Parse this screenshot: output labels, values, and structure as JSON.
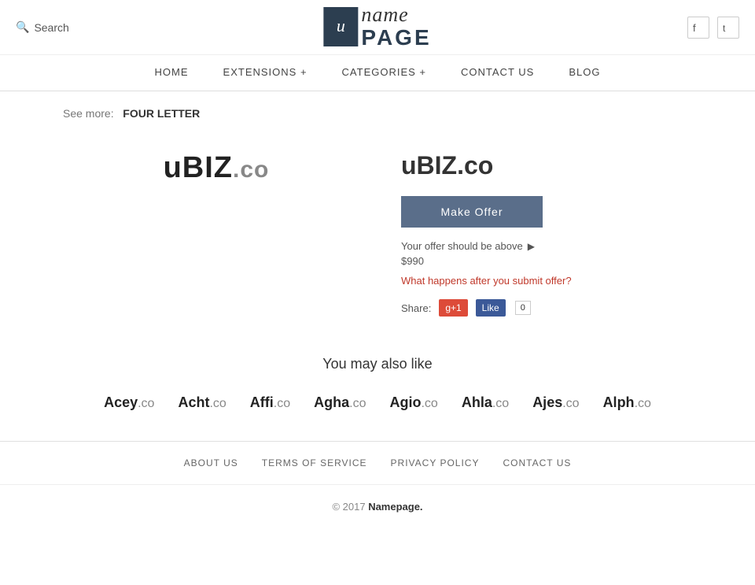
{
  "header": {
    "search_label": "Search",
    "logo_icon_text": "u",
    "logo_name": "name",
    "logo_page": "PAGE",
    "social": {
      "facebook_icon": "f",
      "twitter_icon": "t"
    }
  },
  "nav": {
    "items": [
      {
        "label": "HOME",
        "has_dropdown": false
      },
      {
        "label": "EXTENSIONS +",
        "has_dropdown": true
      },
      {
        "label": "CATEGORIES +",
        "has_dropdown": true
      },
      {
        "label": "CONTACT US",
        "has_dropdown": false
      },
      {
        "label": "BLOG",
        "has_dropdown": false
      }
    ]
  },
  "breadcrumb": {
    "see_more_label": "See more:",
    "link_text": "FOUR LETTER"
  },
  "domain": {
    "name_bold": "uBIZ",
    "name_tld": ".co",
    "title": "uBIZ.co",
    "make_offer_label": "Make Offer",
    "offer_info": "Your offer should be above",
    "offer_price": "$990",
    "what_happens_label": "What happens after you submit offer?",
    "share_label": "Share:",
    "gplus_label": "g+1",
    "fb_like_label": "Like",
    "fb_count": "0"
  },
  "also_like": {
    "title": "You may also like",
    "domains": [
      {
        "name": "Acey",
        "tld": ".co"
      },
      {
        "name": "Acht",
        "tld": ".co"
      },
      {
        "name": "Affi",
        "tld": ".co"
      },
      {
        "name": "Agha",
        "tld": ".co"
      },
      {
        "name": "Agio",
        "tld": ".co"
      },
      {
        "name": "Ahla",
        "tld": ".co"
      },
      {
        "name": "Ajes",
        "tld": ".co"
      },
      {
        "name": "Alph",
        "tld": ".co"
      }
    ]
  },
  "footer": {
    "links": [
      {
        "label": "ABOUT US"
      },
      {
        "label": "TERMS OF SERVICE"
      },
      {
        "label": "PRIVACY POLICY"
      },
      {
        "label": "CONTACT US"
      }
    ],
    "copyright": "© 2017",
    "namepage_link": "Namepage."
  }
}
